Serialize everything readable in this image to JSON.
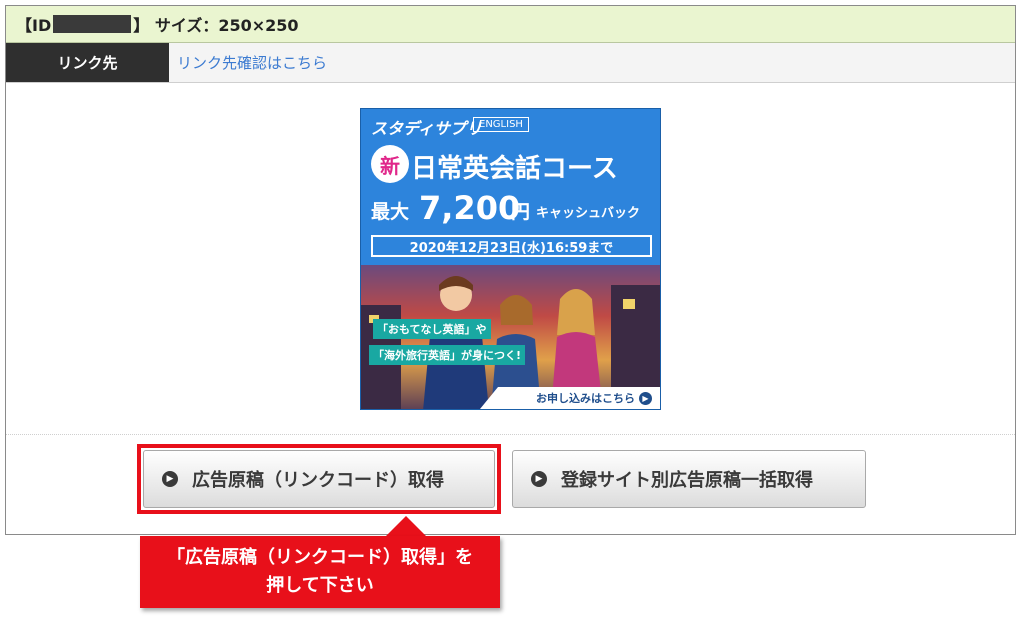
{
  "header": {
    "id_prefix": "【ID",
    "id_suffix": "】 サイズ：250×250"
  },
  "link": {
    "label": "リンク先",
    "value": "リンク先確認はこちら"
  },
  "banner": {
    "brand": "スタディサプリ",
    "brand_tag": "ENGLISH",
    "new_badge": "新",
    "course": "日常英会話コース",
    "cashback_prefix": "最大",
    "cashback_amount": "7,200",
    "cashback_unit": "円",
    "cashback_suffix": "キャッシュバック",
    "deadline": "2020年12月23日(水)16:59まで",
    "pill1": "「おもてなし英語」や",
    "pill2": "「海外旅行英語」が身につく!",
    "cta": "お申し込みはこちら"
  },
  "buttons": {
    "get": "広告原稿（リンクコード）取得",
    "bulk": "登録サイト別広告原稿一括取得"
  },
  "callout": {
    "line1": "「広告原稿（リンクコード）取得」を",
    "line2": "押して下さい"
  },
  "colors": {
    "header_bg": "#eaf5d0",
    "accent_red": "#e8101a",
    "link_blue": "#3c7bd1"
  }
}
